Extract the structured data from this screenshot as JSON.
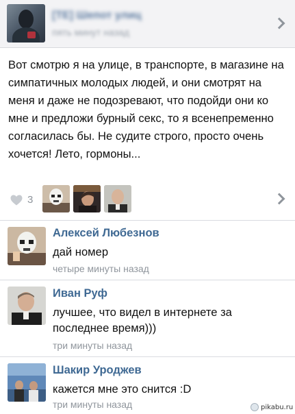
{
  "post": {
    "author": "[TE] Шепот улиц",
    "time": "пять минут назад",
    "text": "Вот смотрю я на улице, в транспорте, в магазине на симпатичных молодых людей, и они смотрят на меня и даже не подозревают, что подойди они ко мне и предложи бурный секс, то я всенепременно согласилась бы. Не судите строго, просто очень хочется! Лето, гормоны..."
  },
  "likes": {
    "count": "3",
    "icon": "heart-icon",
    "likers": [
      "liker-avatar",
      "liker-avatar",
      "liker-avatar"
    ]
  },
  "comments": [
    {
      "name": "Алексей Любезнов",
      "text": "дай номер",
      "time": "четыре минуты назад"
    },
    {
      "name": "Иван Руф",
      "text": "лучшее, что видел в интернете за последнее время)))",
      "time": "три минуты назад"
    },
    {
      "name": "Шакир Уроджев",
      "text": "кажется мне это снится :D",
      "time": "три минуты назад"
    }
  ],
  "watermark": "pikabu.ru",
  "colors": {
    "name_link": "#3f6993",
    "secondary_text": "#8f959c",
    "header_bg": "#f3f3f5"
  }
}
